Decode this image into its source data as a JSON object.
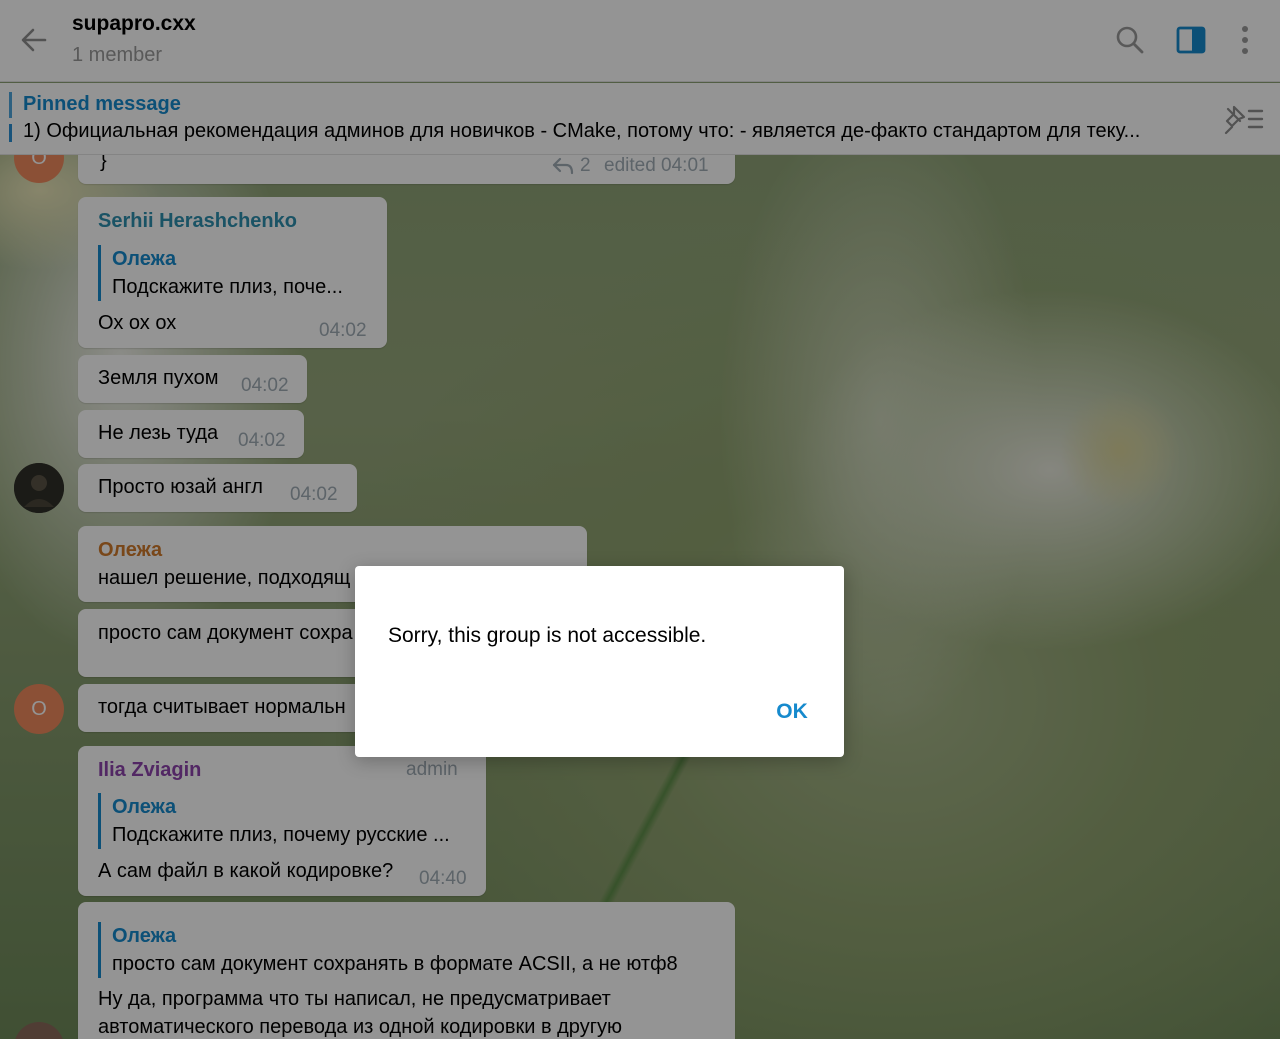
{
  "header": {
    "title": "supapro.cxx",
    "subtitle": "1 member"
  },
  "pinned": {
    "title": "Pinned message",
    "text": "1) Официальная рекомендация админов для новичков - CMake, потому что: - является де-факто стандартом для теку..."
  },
  "messages": {
    "top_partial": {
      "text": "}",
      "replies": "2",
      "edited": "edited 04:01"
    },
    "m1": {
      "sender": "Serhii Herashchenko",
      "quote_name": "Олежа",
      "quote_text": "Подскажите плиз, поче...",
      "text": "Ох ох ох",
      "time": "04:02"
    },
    "m2": {
      "text": "Земля пухом",
      "time": "04:02"
    },
    "m3": {
      "text": "Не лезь туда",
      "time": "04:02"
    },
    "m4": {
      "text": "Просто юзай англ",
      "time": "04:02"
    },
    "m5": {
      "sender": "Олежа",
      "text": "нашел решение, подходящ"
    },
    "m6": {
      "text": "просто сам документ сохра"
    },
    "m7": {
      "text": "тогда считывает нормальн",
      "avatar_letter": "О"
    },
    "m8": {
      "sender": "Ilia Zviagin",
      "badge": "admin",
      "quote_name": "Олежа",
      "quote_text": "Подскажите плиз, почему русские ...",
      "text": "А сам файл в какой кодировке?",
      "time": "04:40"
    },
    "m9": {
      "quote_name": "Олежа",
      "quote_text": "просто сам документ сохранять в формате ACSII, а не ютф8",
      "text_line1": "Ну да, программа что ты написал, не предусматривает",
      "text_line2": "автоматического перевода из одной кодировки в другую"
    },
    "top_avatar_letter": "О"
  },
  "dialog": {
    "text": "Sorry, this group is not accessible.",
    "ok_label": "OK"
  },
  "colors": {
    "accent": "#168acd",
    "sender_serhii": "#2e8fae",
    "sender_olezha": "#d07b2c",
    "sender_ilia": "#8e44ad",
    "avatar_orange": "#f08a5d"
  }
}
